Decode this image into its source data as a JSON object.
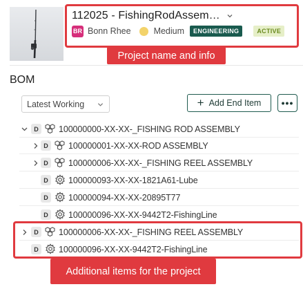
{
  "project": {
    "title": "112025 - FishingRodAssem…",
    "owner_initials": "BR",
    "owner_name": "Bonn Rhee",
    "priority": "Medium",
    "category_tag": "ENGINEERING",
    "status_tag": "ACTIVE"
  },
  "colors": {
    "accent": "#1e5a4e",
    "avatar": "#d62e7a",
    "priority_medium": "#f3d36b",
    "annotation": "#e03a3f"
  },
  "annotations": {
    "top_callout": "Project name and info",
    "bottom_callout": "Additional items for the project"
  },
  "bom": {
    "heading": "BOM",
    "version_select": "Latest Working",
    "add_button": "Add End Item",
    "more_button": "•••",
    "items": [
      {
        "badge": "D",
        "icon": "assembly-icon",
        "expand": "down",
        "label": "100000000-XX-XX-_FISHING ROD ASSEMBLY"
      },
      {
        "badge": "D",
        "icon": "assembly-icon",
        "expand": "right",
        "label": "100000001-XX-XX-ROD ASSEMBLY"
      },
      {
        "badge": "D",
        "icon": "assembly-icon",
        "expand": "right",
        "label": "100000006-XX-XX-_FISHING REEL ASSEMBLY"
      },
      {
        "badge": "D",
        "icon": "part-icon",
        "expand": "none",
        "label": "100000093-XX-XX-1821A61-Lube"
      },
      {
        "badge": "D",
        "icon": "part-icon",
        "expand": "none",
        "label": "100000094-XX-XX-20895T77"
      },
      {
        "badge": "D",
        "icon": "part-icon",
        "expand": "none",
        "label": "100000096-XX-XX-9442T2-FishingLine"
      },
      {
        "badge": "D",
        "icon": "assembly-icon",
        "expand": "right",
        "label": "100000006-XX-XX-_FISHING REEL ASSEMBLY"
      },
      {
        "badge": "D",
        "icon": "part-icon",
        "expand": "none",
        "label": "100000096-XX-XX-9442T2-FishingLine"
      }
    ]
  }
}
